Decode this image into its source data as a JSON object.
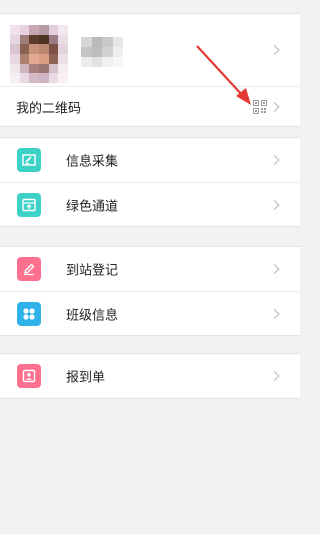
{
  "profile": {
    "qr_label": "我的二维码"
  },
  "menu_group_1": [
    {
      "label": "信息采集",
      "icon": "edit-form-icon",
      "color": "#3ed1c8"
    },
    {
      "label": "绿色通道",
      "icon": "green-channel-icon",
      "color": "#3ed1c8"
    }
  ],
  "menu_group_2": [
    {
      "label": "到站登记",
      "icon": "pen-icon",
      "color": "#ff6f8e"
    },
    {
      "label": "班级信息",
      "icon": "grid-icon",
      "color": "#2fb2ea"
    }
  ],
  "menu_group_3": [
    {
      "label": "报到单",
      "icon": "id-card-icon",
      "color": "#ff6f8e"
    }
  ],
  "colors": {
    "background": "#f2f2f2",
    "annotation_arrow": "#e53935"
  }
}
